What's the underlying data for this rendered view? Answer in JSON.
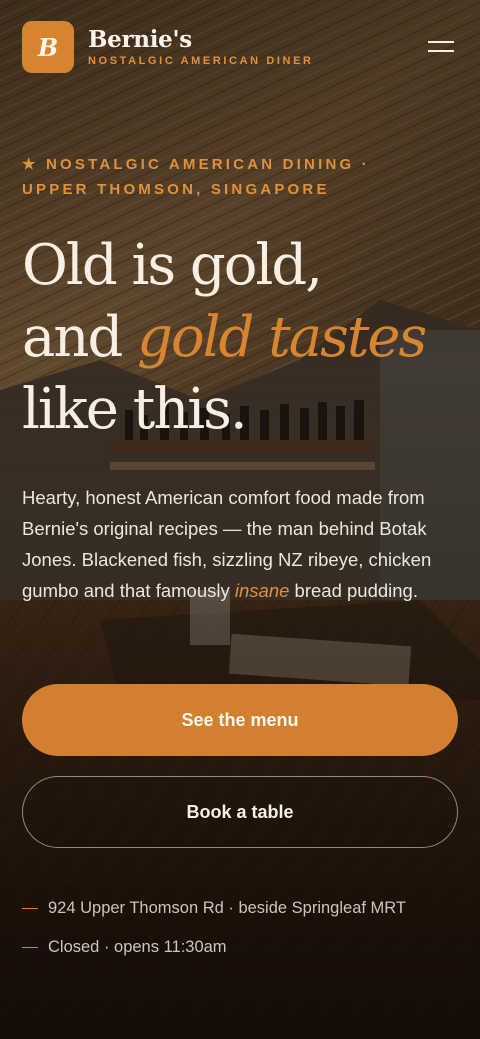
{
  "header": {
    "logo_letter": "B",
    "brand_name": "Bernie's",
    "brand_tagline": "NOSTALGIC AMERICAN DINER",
    "menu_icon": "hamburger-menu-icon"
  },
  "hero": {
    "eyebrow": "★ NOSTALGIC AMERICAN DINING · UPPER THOMSON, SINGAPORE",
    "headline_line1": "Old is gold,",
    "headline_line2_plain": "and ",
    "headline_line2_accent": "gold tastes",
    "headline_line3": "like this.",
    "lede_before": "Hearty, honest American comfort food made from Bernie's original recipes — the man behind Botak Jones. Blackened fish, sizzling NZ ribeye, chicken gumbo and that famously ",
    "lede_em": "insane",
    "lede_after": " bread pudding.",
    "primary_button": "See the menu",
    "secondary_button": "Book a table",
    "address": "924 Upper Thomson Rd · beside Springleaf MRT",
    "hours": "Closed · opens 11:30am"
  },
  "colors": {
    "accent": "#d27f30",
    "text": "#f7efe3",
    "background": "#1a120c"
  }
}
